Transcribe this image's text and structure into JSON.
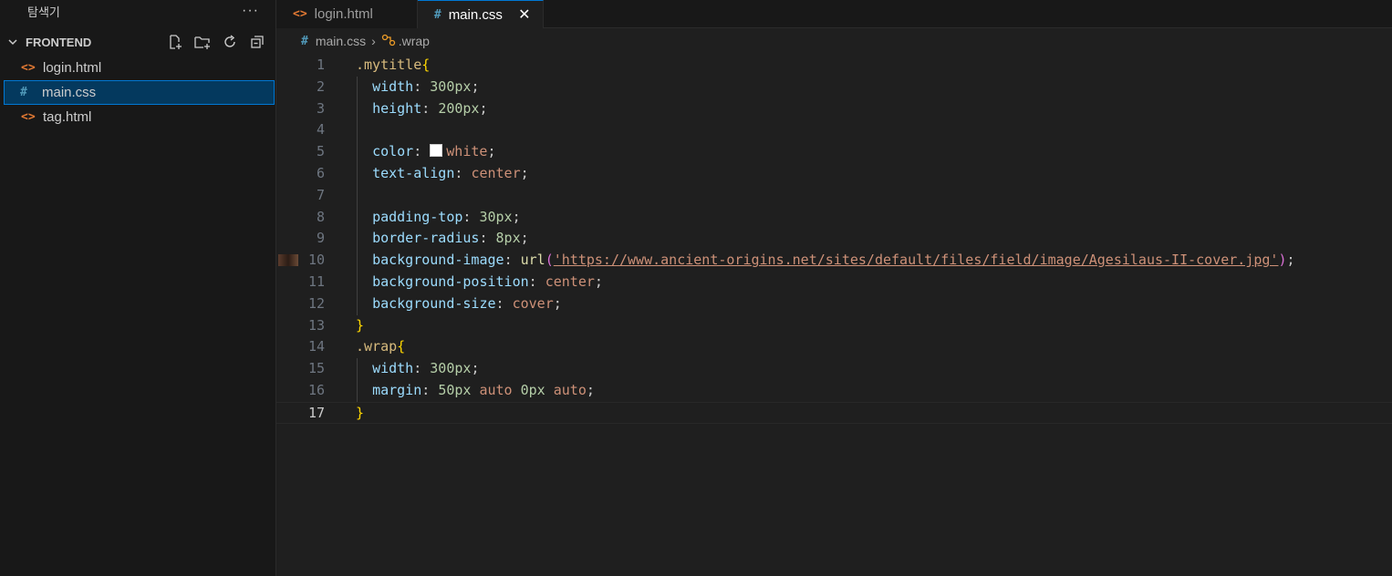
{
  "sidebar": {
    "title": "탐색기",
    "more_label": "···",
    "section": "FRONTEND",
    "actions": [
      {
        "name": "new-file-icon"
      },
      {
        "name": "new-folder-icon"
      },
      {
        "name": "refresh-icon"
      },
      {
        "name": "collapse-all-icon"
      }
    ],
    "files": [
      {
        "icon": "<>",
        "type": "html",
        "label": "login.html",
        "selected": false
      },
      {
        "icon": "#",
        "type": "css",
        "label": "main.css",
        "selected": true
      },
      {
        "icon": "<>",
        "type": "html",
        "label": "tag.html",
        "selected": false
      }
    ]
  },
  "tabs": [
    {
      "icon": "<>",
      "type": "html",
      "label": "login.html",
      "active": false
    },
    {
      "icon": "#",
      "type": "css",
      "label": "main.css",
      "active": true,
      "close": "✕"
    }
  ],
  "breadcrumb": {
    "file": "main.css",
    "separator": "›",
    "symbol": ".wrap"
  },
  "code": {
    "current_line": 17,
    "lines": [
      {
        "n": "1",
        "t": [
          [
            "sel",
            ".mytitle"
          ],
          [
            "br",
            "{"
          ]
        ]
      },
      {
        "n": "2",
        "t": [
          [
            "pn",
            "  "
          ],
          [
            "prop",
            "width"
          ],
          [
            "pn",
            ": "
          ],
          [
            "num",
            "300px"
          ],
          [
            "pn",
            ";"
          ]
        ]
      },
      {
        "n": "3",
        "t": [
          [
            "pn",
            "  "
          ],
          [
            "prop",
            "height"
          ],
          [
            "pn",
            ": "
          ],
          [
            "num",
            "200px"
          ],
          [
            "pn",
            ";"
          ]
        ]
      },
      {
        "n": "4",
        "t": []
      },
      {
        "n": "5",
        "t": [
          [
            "pn",
            "  "
          ],
          [
            "prop",
            "color"
          ],
          [
            "pn",
            ": "
          ],
          [
            "swatch",
            ""
          ],
          [
            "kw",
            "white"
          ],
          [
            "pn",
            ";"
          ]
        ]
      },
      {
        "n": "6",
        "t": [
          [
            "pn",
            "  "
          ],
          [
            "prop",
            "text-align"
          ],
          [
            "pn",
            ": "
          ],
          [
            "kw",
            "center"
          ],
          [
            "pn",
            ";"
          ]
        ]
      },
      {
        "n": "7",
        "t": []
      },
      {
        "n": "8",
        "t": [
          [
            "pn",
            "  "
          ],
          [
            "prop",
            "padding-top"
          ],
          [
            "pn",
            ": "
          ],
          [
            "num",
            "30px"
          ],
          [
            "pn",
            ";"
          ]
        ]
      },
      {
        "n": "9",
        "t": [
          [
            "pn",
            "  "
          ],
          [
            "prop",
            "border-radius"
          ],
          [
            "pn",
            ": "
          ],
          [
            "num",
            "8px"
          ],
          [
            "pn",
            ";"
          ]
        ]
      },
      {
        "n": "10",
        "thumb": true,
        "t": [
          [
            "pn",
            "  "
          ],
          [
            "prop",
            "background-image"
          ],
          [
            "pn",
            ": "
          ],
          [
            "fn",
            "url"
          ],
          [
            "par",
            "("
          ],
          [
            "str",
            "'https://www.ancient-origins.net/sites/default/files/field/image/Agesilaus-II-cover.jpg'"
          ],
          [
            "par",
            ")"
          ],
          [
            "pn",
            ";"
          ]
        ]
      },
      {
        "n": "11",
        "t": [
          [
            "pn",
            "  "
          ],
          [
            "prop",
            "background-position"
          ],
          [
            "pn",
            ": "
          ],
          [
            "kw",
            "center"
          ],
          [
            "pn",
            ";"
          ]
        ]
      },
      {
        "n": "12",
        "t": [
          [
            "pn",
            "  "
          ],
          [
            "prop",
            "background-size"
          ],
          [
            "pn",
            ": "
          ],
          [
            "kw",
            "cover"
          ],
          [
            "pn",
            ";"
          ]
        ]
      },
      {
        "n": "13",
        "t": [
          [
            "br",
            "}"
          ]
        ]
      },
      {
        "n": "14",
        "t": [
          [
            "sel",
            ".wrap"
          ],
          [
            "br",
            "{"
          ]
        ]
      },
      {
        "n": "15",
        "t": [
          [
            "pn",
            "  "
          ],
          [
            "prop",
            "width"
          ],
          [
            "pn",
            ": "
          ],
          [
            "num",
            "300px"
          ],
          [
            "pn",
            ";"
          ]
        ]
      },
      {
        "n": "16",
        "t": [
          [
            "pn",
            "  "
          ],
          [
            "prop",
            "margin"
          ],
          [
            "pn",
            ": "
          ],
          [
            "num",
            "50px"
          ],
          [
            "pn",
            " "
          ],
          [
            "kw",
            "auto"
          ],
          [
            "pn",
            " "
          ],
          [
            "num",
            "0px"
          ],
          [
            "pn",
            " "
          ],
          [
            "kw",
            "auto"
          ],
          [
            "pn",
            ";"
          ]
        ]
      },
      {
        "n": "17",
        "t": [
          [
            "br",
            "}"
          ]
        ]
      }
    ]
  }
}
